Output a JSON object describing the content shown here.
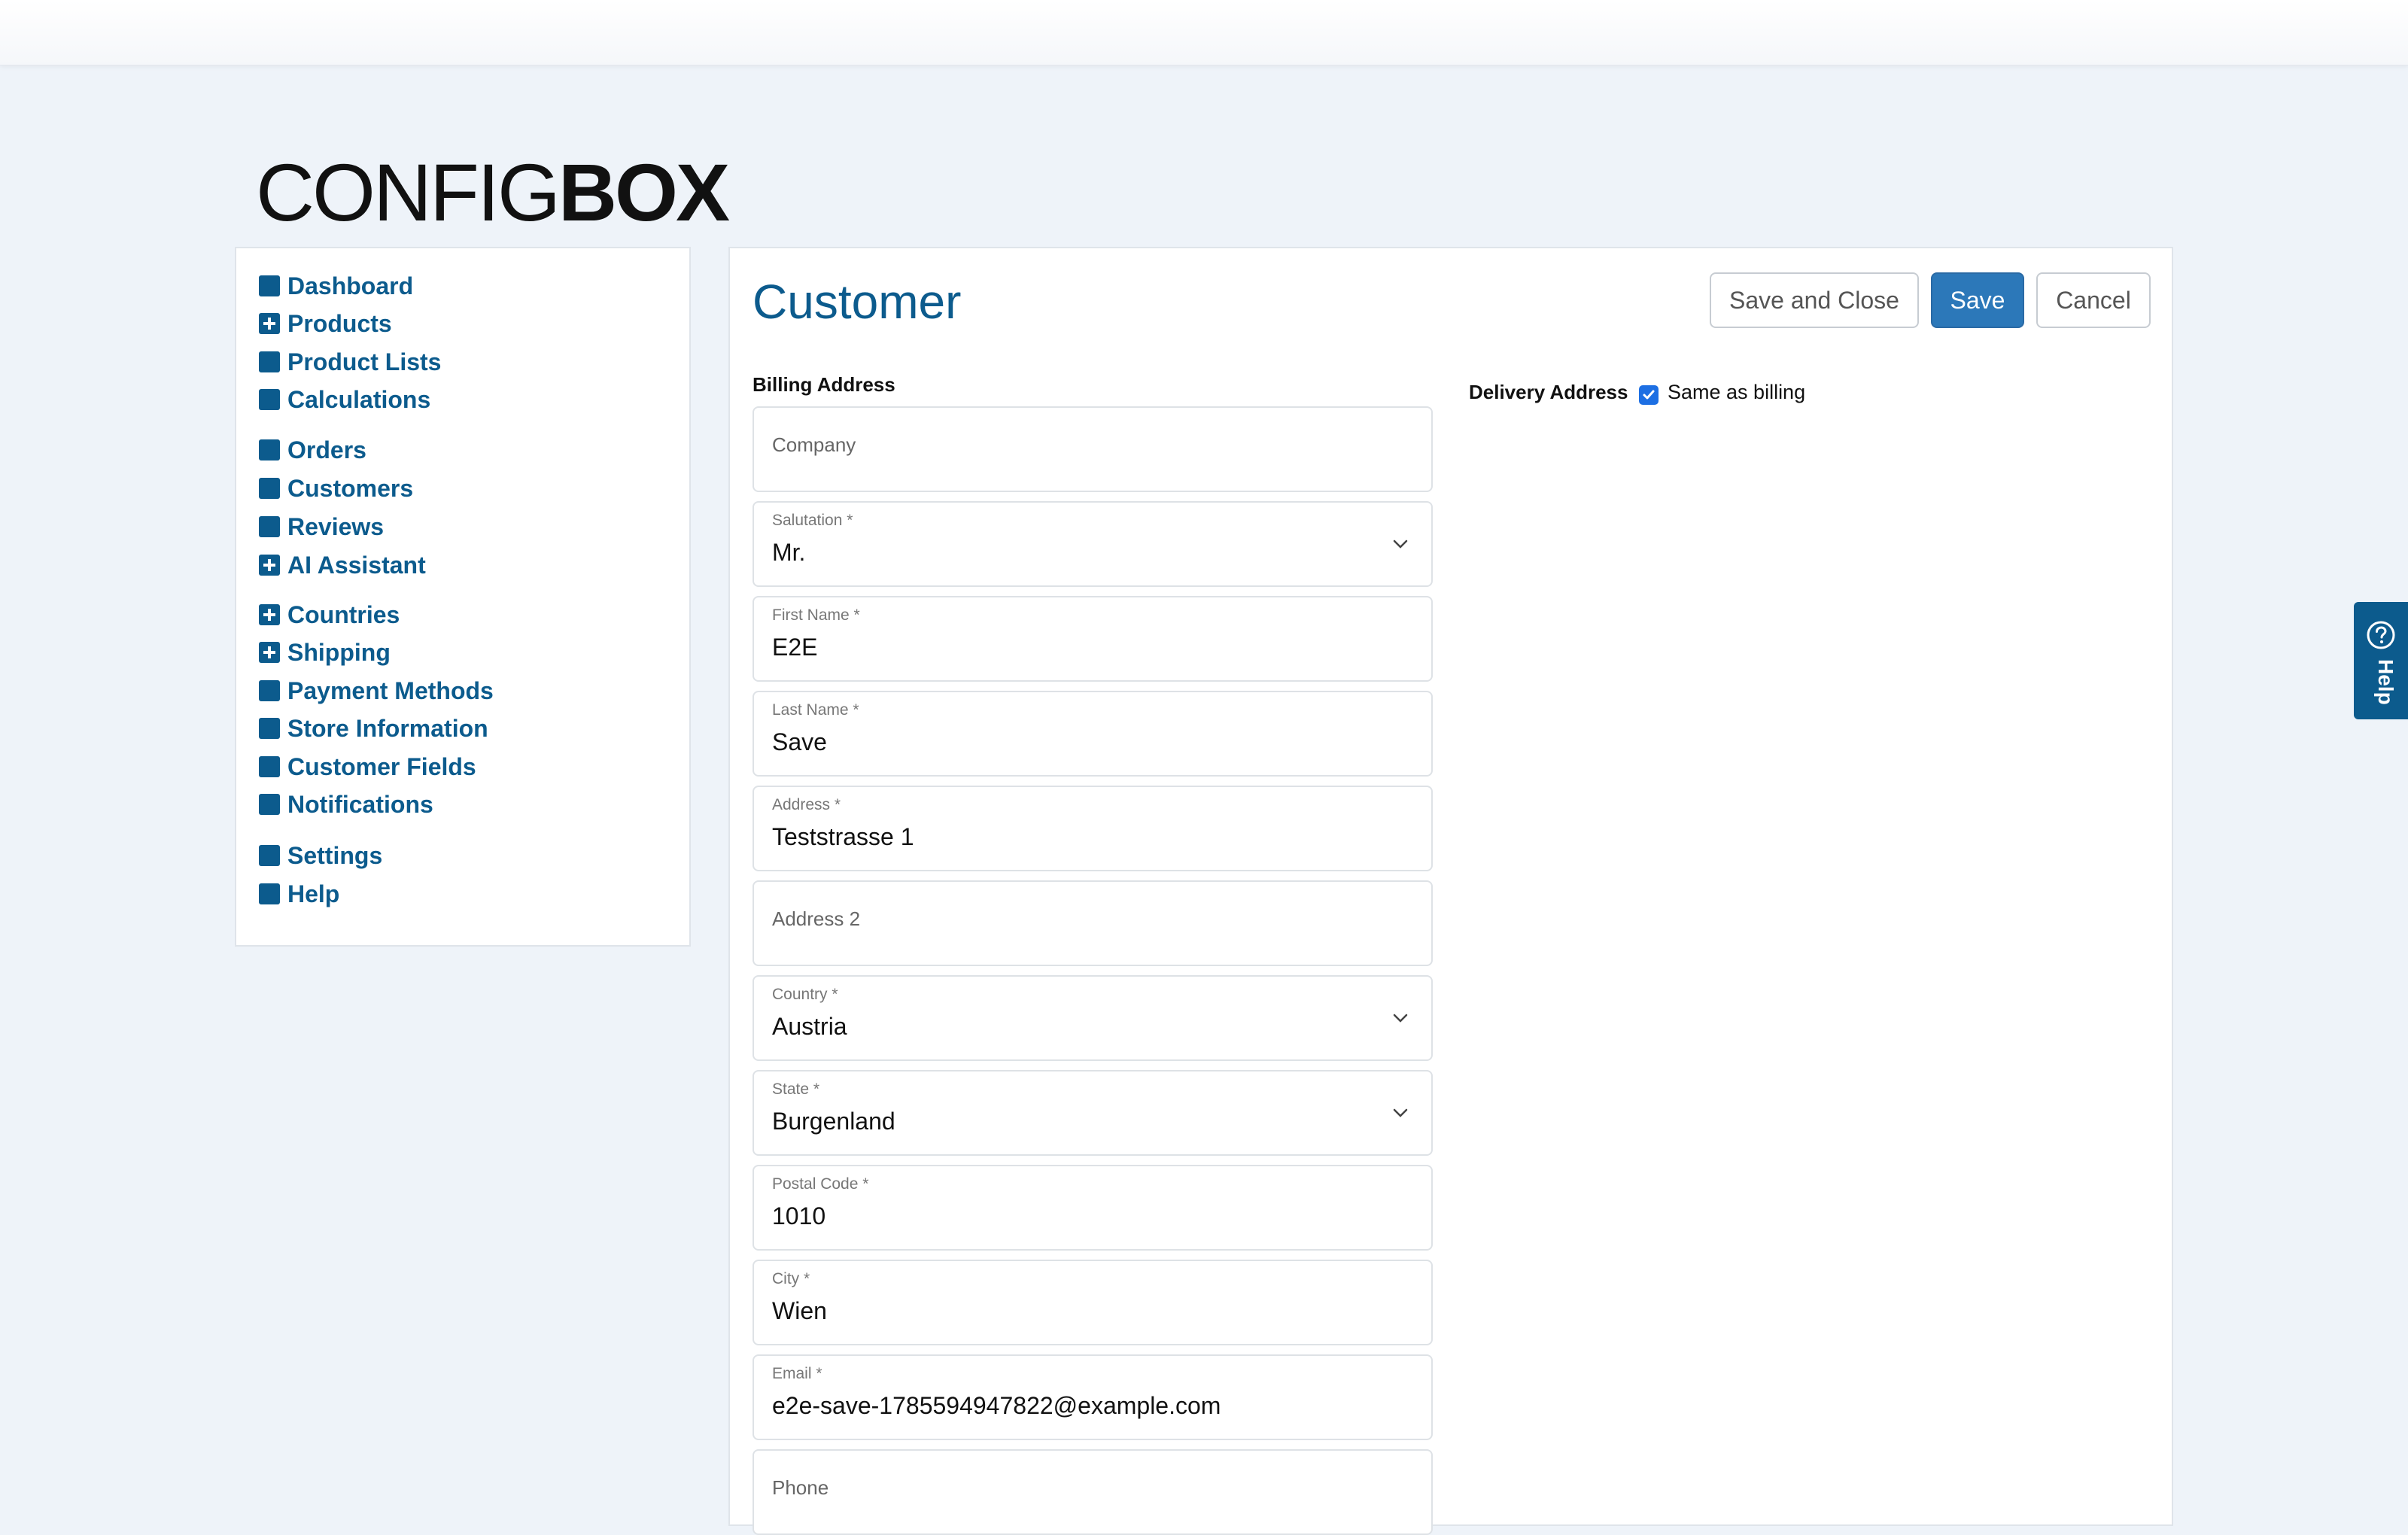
{
  "logo": {
    "light": "CONFIG",
    "bold": "BOX"
  },
  "sidebar": {
    "items": [
      {
        "label": "Dashboard",
        "icon": "square-icon"
      },
      {
        "label": "Products",
        "icon": "plus-box-icon"
      },
      {
        "label": "Product Lists",
        "icon": "square-icon"
      },
      {
        "label": "Calculations",
        "icon": "square-icon"
      },
      {
        "label": "Orders",
        "icon": "square-icon"
      },
      {
        "label": "Customers",
        "icon": "square-icon"
      },
      {
        "label": "Reviews",
        "icon": "square-icon"
      },
      {
        "label": "AI Assistant",
        "icon": "plus-box-icon"
      },
      {
        "label": "Countries",
        "icon": "plus-box-icon"
      },
      {
        "label": "Shipping",
        "icon": "plus-box-icon"
      },
      {
        "label": "Payment Methods",
        "icon": "square-icon"
      },
      {
        "label": "Store Information",
        "icon": "square-icon"
      },
      {
        "label": "Customer Fields",
        "icon": "square-icon"
      },
      {
        "label": "Notifications",
        "icon": "square-icon"
      },
      {
        "label": "Settings",
        "icon": "square-icon"
      },
      {
        "label": "Help",
        "icon": "square-icon"
      }
    ]
  },
  "main": {
    "title": "Customer",
    "buttons": {
      "save_and_close": "Save and Close",
      "save": "Save",
      "cancel": "Cancel"
    },
    "billing_label": "Billing Address",
    "delivery_label": "Delivery Address",
    "same_as_billing": {
      "label": "Same as billing",
      "checked": true
    },
    "fields": {
      "company": {
        "placeholder": "Company"
      },
      "salutation": {
        "label": "Salutation *",
        "value": "Mr."
      },
      "first_name": {
        "label": "First Name *",
        "value": "E2E"
      },
      "last_name": {
        "label": "Last Name *",
        "value": "Save"
      },
      "address": {
        "label": "Address *",
        "value": "Teststrasse 1"
      },
      "address2": {
        "placeholder": "Address 2"
      },
      "country": {
        "label": "Country *",
        "value": "Austria"
      },
      "state": {
        "label": "State *",
        "value": "Burgenland"
      },
      "postal_code": {
        "label": "Postal Code *",
        "value": "1010"
      },
      "city": {
        "label": "City *",
        "value": "Wien"
      },
      "email": {
        "label": "Email *",
        "value": "e2e-save-1785594947822@example.com"
      },
      "phone": {
        "placeholder": "Phone"
      }
    }
  },
  "help_tab": {
    "label": "Help",
    "icon": "question-circle-icon"
  },
  "colors": {
    "brand": "#0c5b8d",
    "primary_button": "#2c78b9",
    "checkbox": "#1d6fe3",
    "background": "#eef3f9"
  }
}
